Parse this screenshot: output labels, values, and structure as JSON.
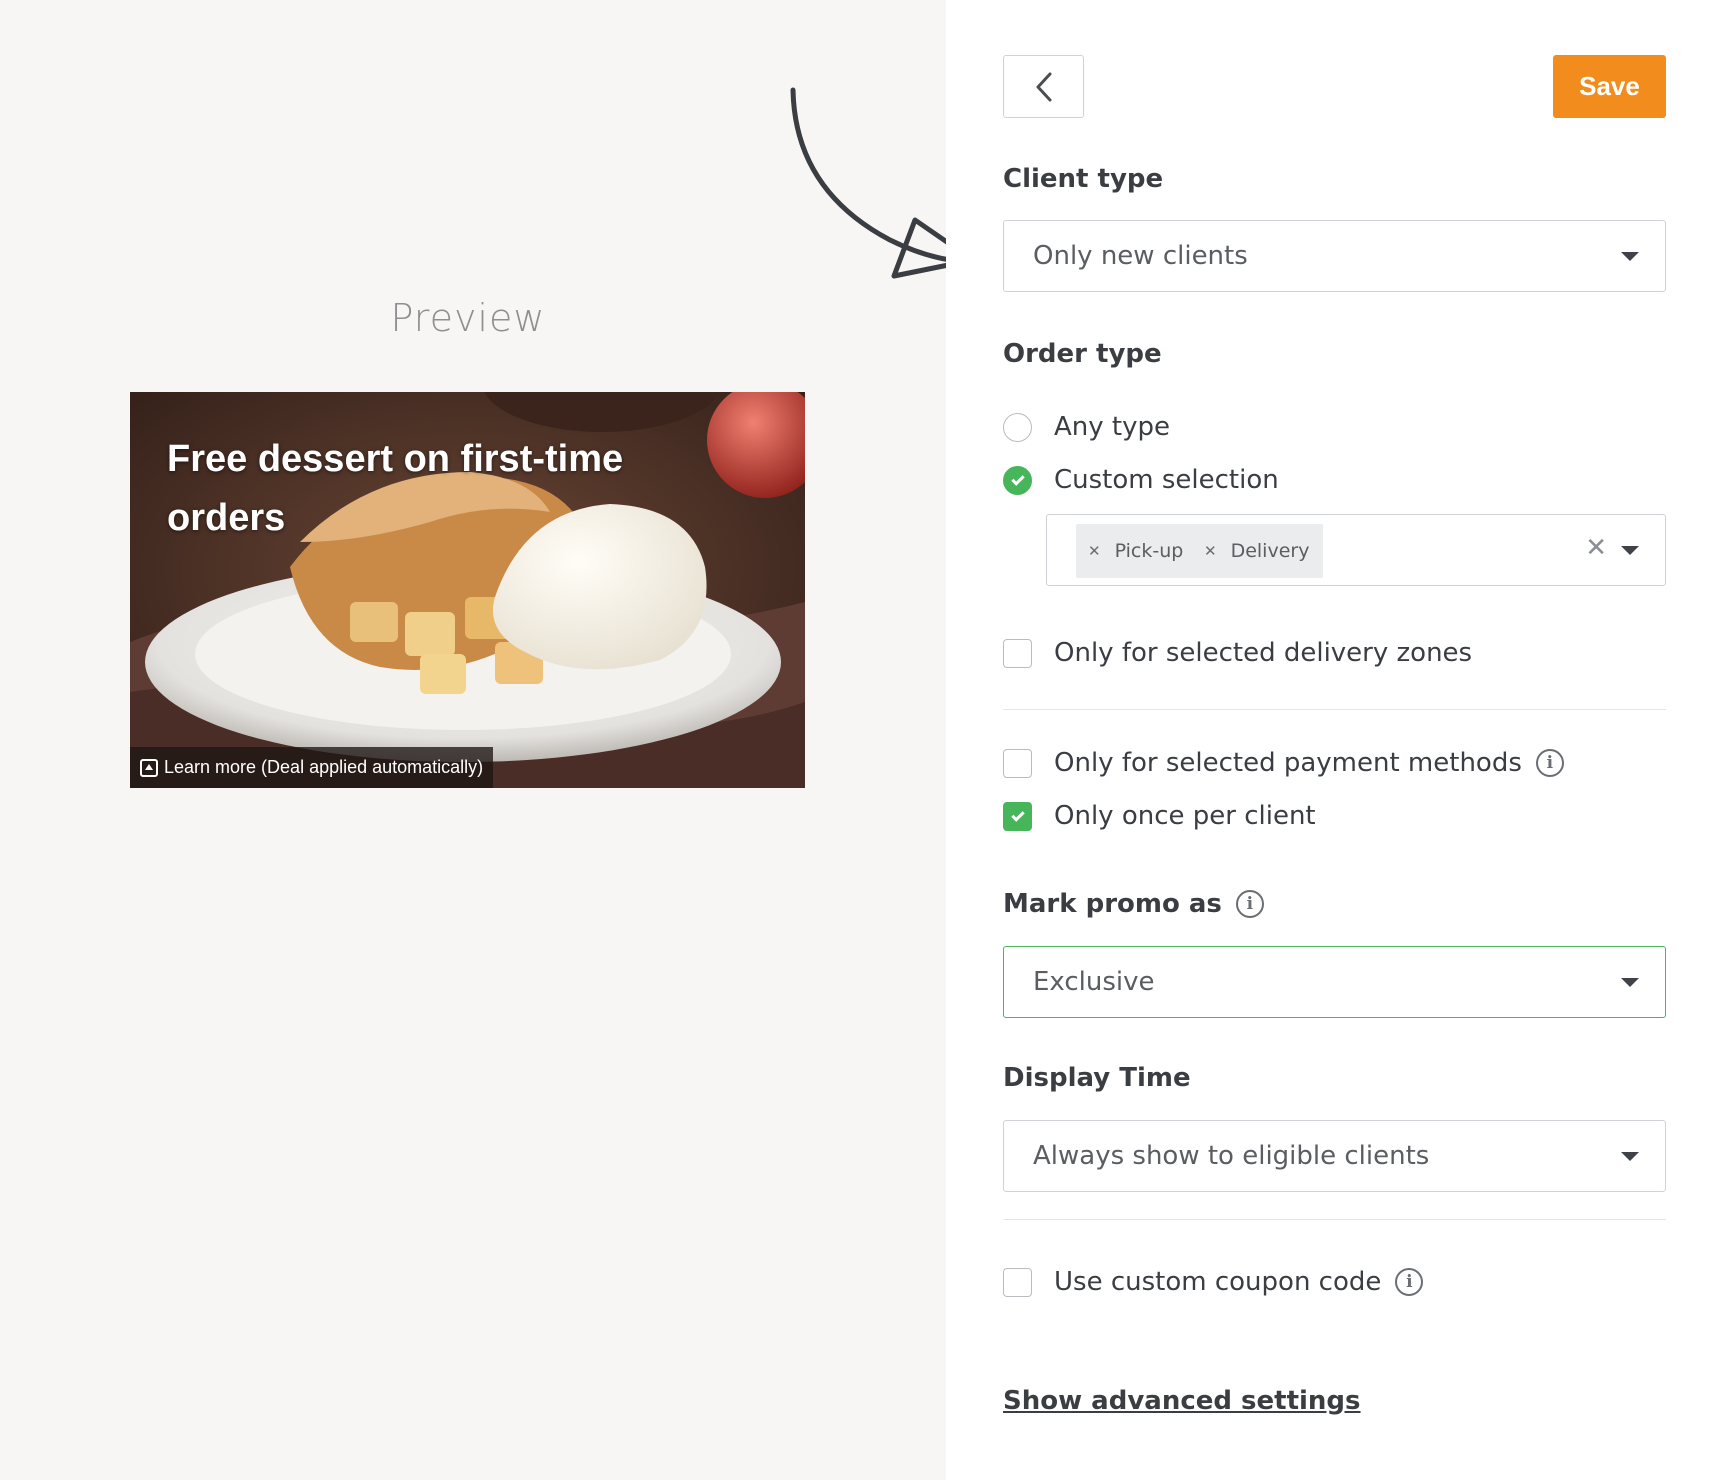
{
  "preview": {
    "title": "Preview",
    "promo_title": "Free dessert on first-time orders",
    "learn_more": "Learn more (Deal applied automatically)"
  },
  "toolbar": {
    "save_label": "Save"
  },
  "client_type": {
    "label": "Client type",
    "value": "Only new clients"
  },
  "order_type": {
    "label": "Order type",
    "options": [
      {
        "label": "Any type",
        "checked": false
      },
      {
        "label": "Custom selection",
        "checked": true
      }
    ],
    "selected_tags": [
      "Pick-up",
      "Delivery"
    ]
  },
  "filters": {
    "delivery_zones": {
      "label": "Only for selected delivery zones",
      "checked": false
    },
    "payment_methods": {
      "label": "Only for selected payment methods",
      "checked": false
    },
    "once_per_client": {
      "label": "Only once per client",
      "checked": true
    }
  },
  "mark_promo": {
    "label": "Mark promo as",
    "value": "Exclusive"
  },
  "display_time": {
    "label": "Display Time",
    "value": "Always show to eligible clients"
  },
  "coupon": {
    "label": "Use custom coupon code",
    "checked": false
  },
  "advanced_link": "Show advanced settings",
  "colors": {
    "accent": "#f28c1c",
    "checked": "#47b55a",
    "left_background": "#f7f6f4"
  }
}
